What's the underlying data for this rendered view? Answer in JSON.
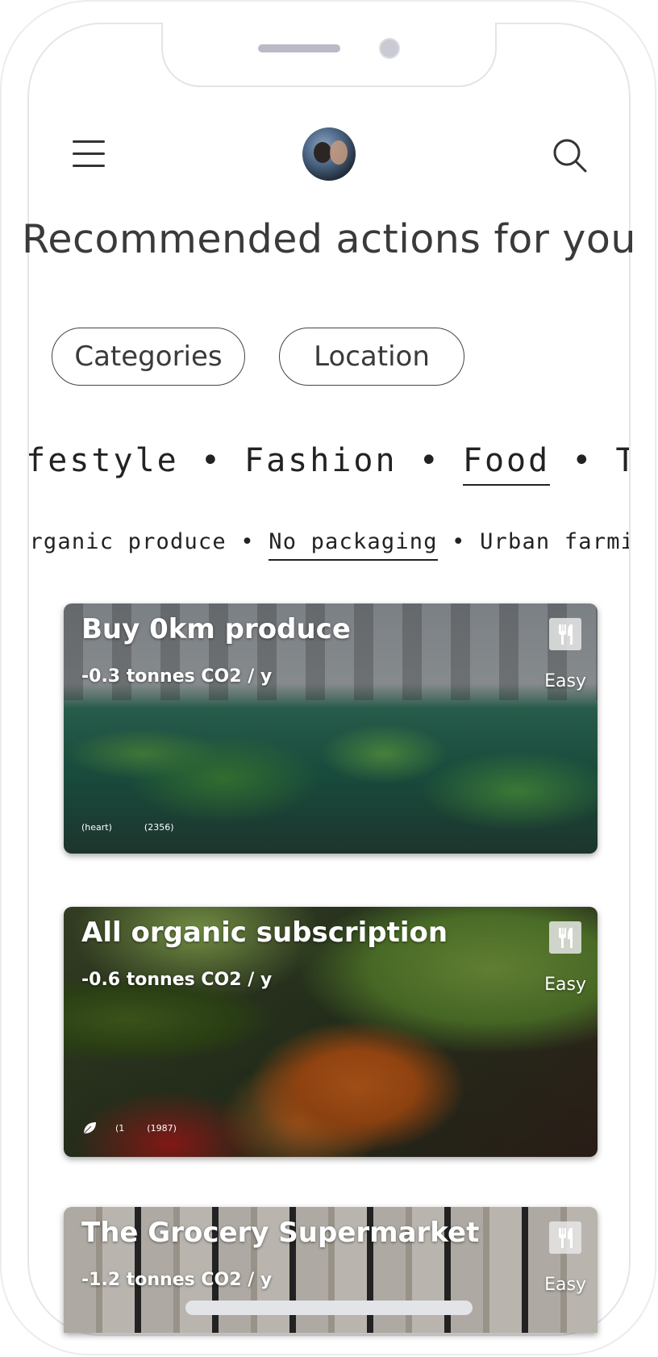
{
  "header": {
    "menu_icon": "hamburger-menu-icon",
    "avatar_icon": "user-avatar",
    "search_icon": "search-icon"
  },
  "page_title": "Recommended actions for you",
  "filters": {
    "categories_label": "Categories",
    "location_label": "Location"
  },
  "categories": {
    "items": [
      "Lifestyle",
      "Fashion",
      "Food",
      "Transport"
    ],
    "selected": "Food",
    "separator": "•"
  },
  "subcategories": {
    "items": [
      "Organic produce",
      "No packaging",
      "Urban farming"
    ],
    "selected": "No packaging",
    "separator": "•"
  },
  "cards": [
    {
      "title": "Buy 0km produce",
      "co2": "-0.3 tonnes CO2 / y",
      "difficulty": "Easy",
      "category_icon": "fork-knife-icon",
      "footer": [
        "(heart)",
        "(2356)"
      ]
    },
    {
      "title": "All organic subscription",
      "co2": "-0.6 tonnes CO2 / y",
      "difficulty": "Easy",
      "category_icon": "fork-knife-icon",
      "footer_icon": "leaf-icon",
      "footer": [
        "(1",
        "(1987)"
      ]
    },
    {
      "title": "The Grocery Supermarket",
      "co2": "-1.2 tonnes CO2 / y",
      "difficulty": "Easy",
      "category_icon": "fork-knife-icon"
    }
  ]
}
